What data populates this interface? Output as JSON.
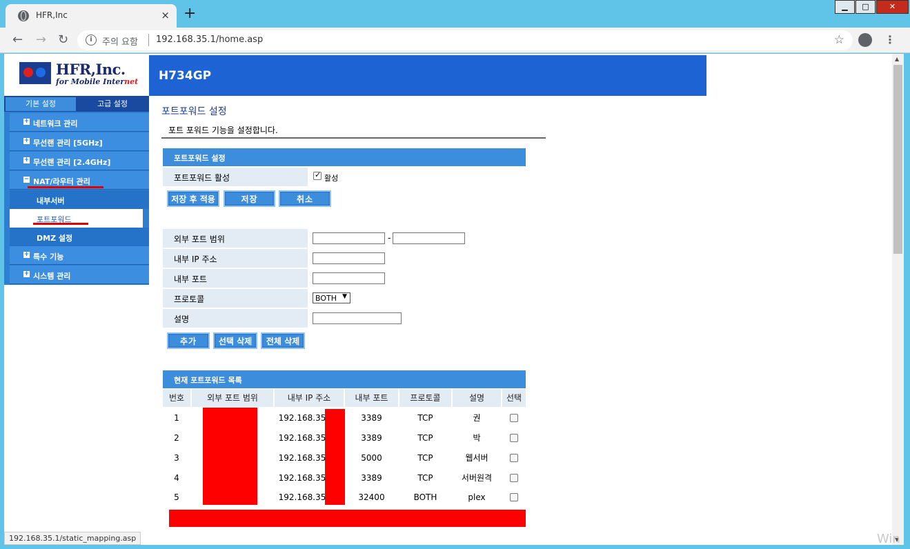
{
  "browser": {
    "tab_title": "HFR,Inc",
    "tab_close": "×",
    "new_tab": "+",
    "security_label": "주의 요함",
    "url": "192.168.35.1/home.asp",
    "status_url": "192.168.35.1/static_mapping.asp",
    "watermark": "Win"
  },
  "header": {
    "brand": "HFR,Inc.",
    "tagline_prefix": "for Mobile Inter",
    "tagline_suffix": "net",
    "model": "H734GP"
  },
  "sidebar": {
    "tab_basic": "기본 설정",
    "tab_advanced": "고급 설정",
    "items": [
      {
        "label": "네트워크 관리",
        "expander": "+"
      },
      {
        "label": "무선랜 관리 [5GHz]",
        "expander": "+"
      },
      {
        "label": "무선랜 관리 [2.4GHz]",
        "expander": "+"
      },
      {
        "label": "NAT/라우터 관리",
        "expander": "−"
      },
      {
        "label": "특수 기능",
        "expander": "+"
      },
      {
        "label": "시스템 관리",
        "expander": "+"
      }
    ],
    "sub_items": [
      {
        "label": "내부서버"
      },
      {
        "label": "포트포워드"
      },
      {
        "label": "DMZ 설정"
      }
    ]
  },
  "page": {
    "title": "포트포워드 설정",
    "description": "포트 포워드 기능을 설정합니다."
  },
  "settings": {
    "header": "포트포워드 설정",
    "enable_label": "포트포워드 활성",
    "enable_checked": true,
    "enable_checkbox_label": "활성",
    "buttons": {
      "save_apply": "저장 후 적용",
      "save": "저장",
      "cancel": "취소"
    }
  },
  "form": {
    "ext_port_label": "외부 포트 범위",
    "range_separator": "-",
    "int_ip_label": "내부 IP 주소",
    "int_port_label": "내부 포트",
    "protocol_label": "프로토콜",
    "protocol_value": "BOTH",
    "description_label": "설명",
    "buttons": {
      "add": "추가",
      "delete_selected": "선택 삭제",
      "delete_all": "전체 삭제"
    }
  },
  "list": {
    "header": "현재 포트포워드 목록",
    "columns": [
      "번호",
      "외부 포트 범위",
      "내부 IP 주소",
      "내부 포트",
      "프로토콜",
      "설명",
      "선택"
    ],
    "rows": [
      {
        "no": "1",
        "ip": "192.168.35",
        "port": "3389",
        "proto": "TCP",
        "desc": "권"
      },
      {
        "no": "2",
        "ip": "192.168.35",
        "port": "3389",
        "proto": "TCP",
        "desc": "박"
      },
      {
        "no": "3",
        "ip": "192.168.35",
        "port": "5000",
        "proto": "TCP",
        "desc": "웹서버"
      },
      {
        "no": "4",
        "ip": "192.168.35",
        "port": "3389",
        "proto": "TCP",
        "desc": "서버원격"
      },
      {
        "no": "5",
        "ip": "192.168.35",
        "port": "32400",
        "proto": "BOTH",
        "desc": "plex"
      }
    ]
  },
  "colors": {
    "accent": "#3c8ddb",
    "banner": "#1d63d3",
    "redaction": "#ff0000"
  }
}
